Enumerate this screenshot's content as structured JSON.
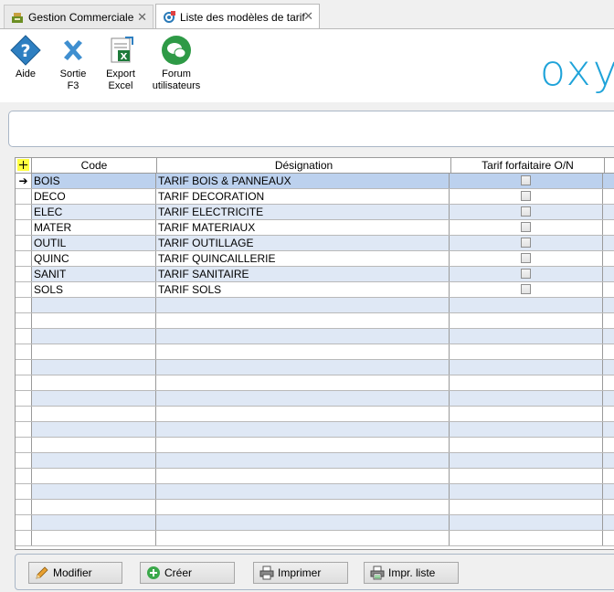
{
  "tabs": [
    {
      "label": "Gestion Commerciale",
      "icon": "cash-register-icon"
    },
    {
      "label": "Liste des modèles de tarif",
      "icon": "gear-icon"
    }
  ],
  "toolbar": {
    "help_label": "Aide",
    "exit_label_1": "Sortie",
    "exit_label_2": "F3",
    "export_label_1": "Export",
    "export_label_2": "Excel",
    "forum_label_1": "Forum",
    "forum_label_2": "utilisateurs"
  },
  "brand": {
    "logo_text": "oxy",
    "color": "#1fa3d9"
  },
  "grid": {
    "headers": {
      "code": "Code",
      "designation": "Désignation",
      "tarif": "Tarif forfaitaire O/N"
    },
    "rows": [
      {
        "code": "BOIS",
        "designation": "TARIF BOIS & PANNEAUX"
      },
      {
        "code": "DECO",
        "designation": "TARIF DECORATION"
      },
      {
        "code": "ELEC",
        "designation": "TARIF ELECTRICITE"
      },
      {
        "code": "MATER",
        "designation": "TARIF MATERIAUX"
      },
      {
        "code": "OUTIL",
        "designation": "TARIF OUTILLAGE"
      },
      {
        "code": "QUINC",
        "designation": "TARIF QUINCAILLERIE"
      },
      {
        "code": "SANIT",
        "designation": "TARIF SANITAIRE"
      },
      {
        "code": "SOLS",
        "designation": "TARIF SOLS"
      }
    ],
    "colors": {
      "alt_row": "#dfe8f5",
      "selected_row": "#bcd1ee"
    }
  },
  "buttons": {
    "modify": "Modifier",
    "create": "Créer",
    "print": "Imprimer",
    "print_list": "Impr. liste"
  }
}
